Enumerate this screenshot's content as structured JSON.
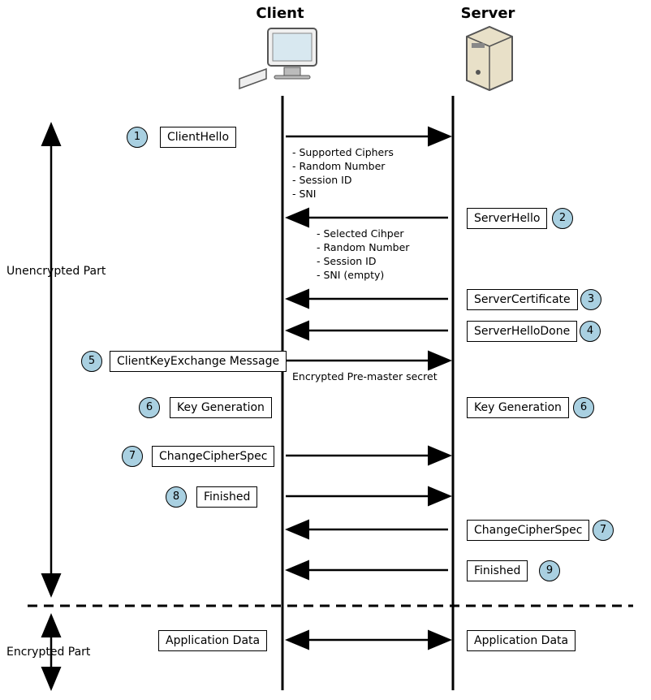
{
  "header": {
    "client": "Client",
    "server": "Server"
  },
  "side_labels": {
    "unencrypted": "Unencrypted Part",
    "encrypted": "Encrypted Part"
  },
  "steps": {
    "s1": {
      "num": "1",
      "label": "ClientHello",
      "details": "- Supported Ciphers\n- Random Number\n- Session ID\n- SNI"
    },
    "s2": {
      "num": "2",
      "label": "ServerHello",
      "details": "- Selected Cihper\n- Random Number\n- Session ID\n- SNI (empty)"
    },
    "s3": {
      "num": "3",
      "label": "ServerCertificate"
    },
    "s4": {
      "num": "4",
      "label": "ServerHelloDone"
    },
    "s5": {
      "num": "5",
      "label": "ClientKeyExchange Message",
      "details": "Encrypted Pre-master secret"
    },
    "s6a": {
      "num": "6",
      "label": "Key Generation"
    },
    "s6b": {
      "num": "6",
      "label": "Key Generation"
    },
    "s7a": {
      "num": "7",
      "label": "ChangeCipherSpec"
    },
    "s7b": {
      "num": "7",
      "label": "ChangeCipherSpec"
    },
    "s8": {
      "num": "8",
      "label": "Finished"
    },
    "s9": {
      "num": "9",
      "label": "Finished"
    },
    "appc": {
      "label": "Application Data"
    },
    "apps": {
      "label": "Application Data"
    }
  }
}
